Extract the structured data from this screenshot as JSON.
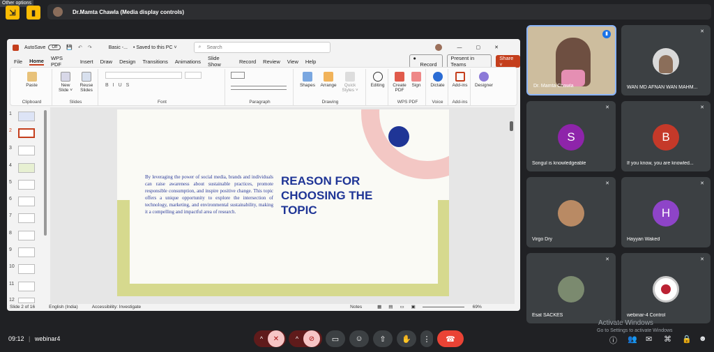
{
  "tooltip": "Other options",
  "presenter_bar": {
    "name": "Dr.Mamta Chawla (Media display controls)"
  },
  "ppt": {
    "autosave": "AutoSave",
    "toggle": "Off",
    "doc_name": "Basic -...",
    "saved": "• Saved to this PC ˅",
    "search_placeholder": "Search",
    "menu": [
      "File",
      "Home",
      "WPS PDF",
      "Insert",
      "Draw",
      "Design",
      "Transitions",
      "Animations",
      "Slide Show",
      "Record",
      "Review",
      "View",
      "Help"
    ],
    "record_btn": "Record",
    "present_btn": "Present in Teams",
    "share_btn": "Share ˅",
    "ribbon_groups": [
      {
        "label": "Clipboard",
        "items": [
          "Paste"
        ]
      },
      {
        "label": "Slides",
        "items": [
          "New Slide ˅",
          "Reuse Slides"
        ]
      },
      {
        "label": "Font",
        "items": []
      },
      {
        "label": "Paragraph",
        "items": []
      },
      {
        "label": "Drawing",
        "items": [
          "Shapes",
          "Arrange",
          "Quick Styles ˅"
        ]
      },
      {
        "label": "",
        "items": [
          "Editing"
        ]
      },
      {
        "label": "WPS PDF",
        "items": [
          "Create PDF",
          "Sign"
        ]
      },
      {
        "label": "Voice",
        "items": [
          "Dictate"
        ]
      },
      {
        "label": "Add-ins",
        "items": [
          "Add-ins"
        ]
      },
      {
        "label": "",
        "items": [
          "Designer"
        ]
      }
    ],
    "slide_numbers": [
      "1",
      "2",
      "3",
      "4",
      "5",
      "6",
      "7",
      "8",
      "9",
      "10",
      "11",
      "12"
    ],
    "slide": {
      "body": "By leveraging the power of social media, brands and individuals can raise awareness about sustainable practices, promote responsible consumption, and inspire positive change. This topic offers a unique opportunity to explore the intersection of technology, marketing, and environmental sustainability, making it a compelling and impactful area of research.",
      "title_line1": "REASON FOR",
      "title_line2": "CHOOSING THE",
      "title_line3": "TOPIC"
    },
    "status": {
      "slide": "Slide 2 of 16",
      "lang": "English (India)",
      "accessibility": "Accessibility: Investigate",
      "notes": "Notes",
      "zoom": "69%"
    }
  },
  "participants": [
    {
      "name": "Dr. Mamta Chawla"
    },
    {
      "name": "WAN MD AFNAN WAN MAHM..."
    },
    {
      "name": "Songul is knowledgeable",
      "initial": "S",
      "color": "#8e24aa"
    },
    {
      "name": "If you know, you are knowled...",
      "initial": "B",
      "color": "#c53929"
    },
    {
      "name": "Virgo Dry"
    },
    {
      "name": "Hayyan Waked",
      "initial": "H",
      "color": "#8e44c8"
    },
    {
      "name": "Esat SACKES"
    },
    {
      "name": "webinar-4 Control"
    }
  ],
  "meeting": {
    "time": "09:12",
    "name": "webinar4"
  },
  "activate": {
    "line1": "Activate Windows",
    "line2": "Go to Settings to activate Windows"
  }
}
